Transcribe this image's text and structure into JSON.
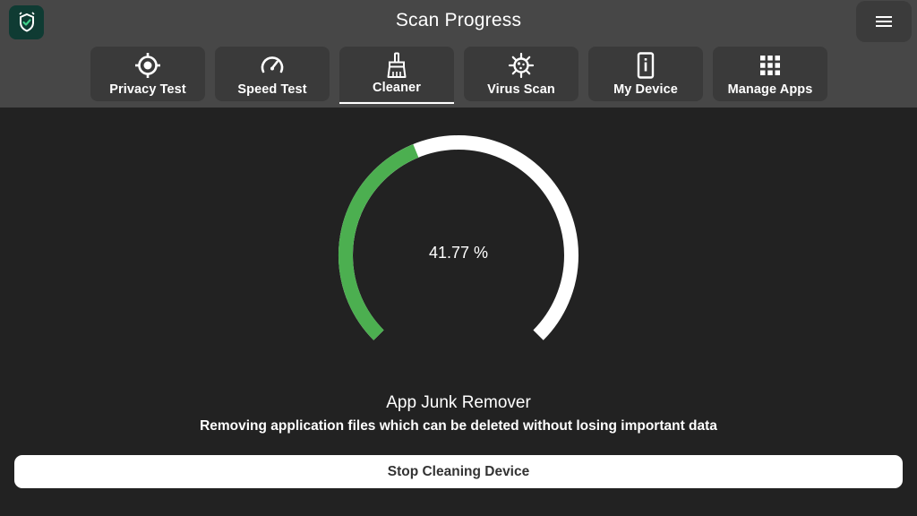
{
  "header": {
    "title": "Scan Progress",
    "logo_icon": "shield-check-icon",
    "menu_icon": "hamburger-menu-icon"
  },
  "tabs": [
    {
      "label": "Privacy Test",
      "icon": "crosshair-icon"
    },
    {
      "label": "Speed Test",
      "icon": "speedometer-icon"
    },
    {
      "label": "Cleaner",
      "icon": "broom-icon",
      "active": true
    },
    {
      "label": "Virus Scan",
      "icon": "virus-icon"
    },
    {
      "label": "My Device",
      "icon": "phone-info-icon"
    },
    {
      "label": "Manage Apps",
      "icon": "apps-grid-icon"
    }
  ],
  "progress": {
    "value_text": "41.77 %",
    "value": 41.77,
    "progress_color": "#4caf50",
    "track_color": "#ffffff"
  },
  "task": {
    "title": "App Junk Remover",
    "description": "Removing application files which can be deleted without losing important data"
  },
  "stop_button": {
    "label": "Stop Cleaning Device"
  },
  "colors": {
    "header_bg": "#474747",
    "body_bg": "#222222",
    "tab_bg": "#3a3a3a"
  }
}
